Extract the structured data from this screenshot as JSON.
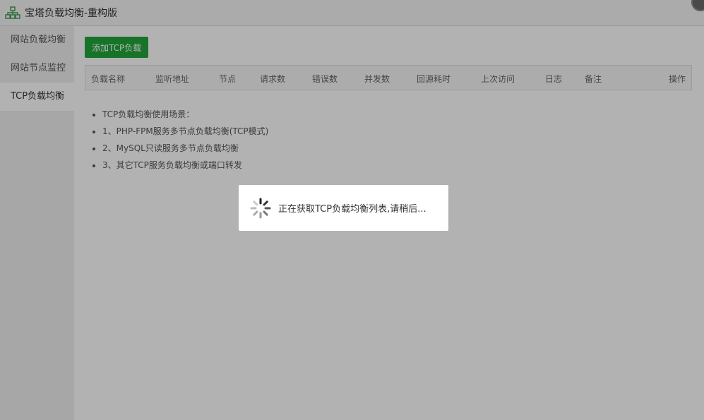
{
  "window": {
    "title": "宝塔负载均衡-重构版",
    "app_icon": "network-nodes-icon"
  },
  "sidebar": {
    "items": [
      {
        "label": "网站负载均衡"
      },
      {
        "label": "网站节点监控"
      },
      {
        "label": "TCP负载均衡"
      }
    ]
  },
  "main": {
    "add_button": "添加TCP负载",
    "table_headers": [
      "负载名称",
      "监听地址",
      "节点",
      "请求数",
      "错误数",
      "并发数",
      "回源耗时",
      "上次访问",
      "日志",
      "备注",
      "操作"
    ],
    "tips": [
      "TCP负载均衡使用场景：",
      "1、PHP-FPM服务多节点负载均衡(TCP模式)",
      "2、MySQL只读服务多节点负载均衡",
      "3、其它TCP服务负载均衡或端口转发"
    ]
  },
  "loading": {
    "text": "正在获取TCP负载均衡列表,请稍后..."
  },
  "colors": {
    "accent": "#20a53a",
    "overlay": "rgba(0,0,0,0.3)"
  }
}
